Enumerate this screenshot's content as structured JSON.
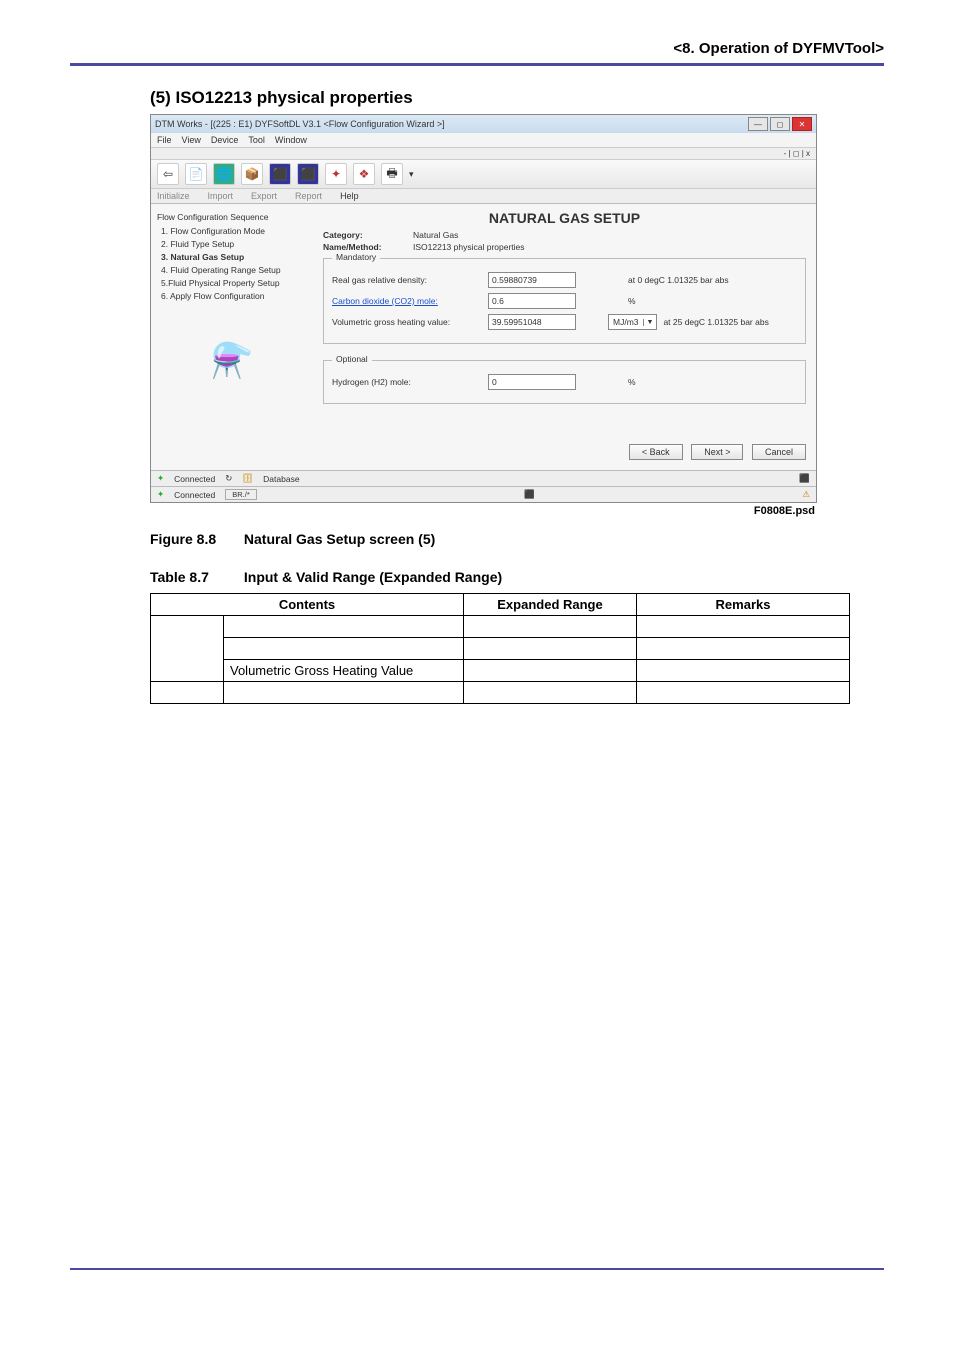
{
  "header": {
    "text": "<8.  Operation of DYFMVTool>"
  },
  "section": {
    "title": "(5)   ISO12213 physical properties"
  },
  "window": {
    "title": "DTM Works - [(225 : E1) DYFSoftDL V3.1 <Flow Configuration Wizard >]",
    "mdi_controls": "- | ◻ | x",
    "menu": {
      "file": "File",
      "view": "View",
      "device": "Device",
      "tool": "Tool",
      "window": "Window"
    },
    "toolbar_icons": {
      "back": "⇦",
      "doc": "📄",
      "globe": "🌐",
      "box": "📦",
      "a1": "⬛",
      "a2": "⬛",
      "wiz1": "✦",
      "wiz2": "❖",
      "print": "🖶",
      "drop": "▾"
    },
    "sectabs": {
      "initialize": "Initialize",
      "import": "Import",
      "export": "Export",
      "report": "Report",
      "help": "Help"
    },
    "sidebar": {
      "group": "Flow Configuration Sequence",
      "steps": {
        "s1": "1. Flow Configuration Mode",
        "s2": "2. Fluid Type Setup",
        "s3": "3. Natural Gas Setup",
        "s4": "4. Fluid Operating Range Setup",
        "s5": "5.Fluid Physical Property Setup",
        "s6": "6. Apply Flow Configuration"
      },
      "art": "⚗️"
    },
    "main": {
      "title": "NATURAL GAS SETUP",
      "catlbl": "Category:",
      "catval": "Natural Gas",
      "methlbl": "Name/Method:",
      "methval": "ISO12213 physical properties",
      "mandatory": {
        "legend": "Mandatory",
        "row1": {
          "label": "Real gas relative density:",
          "value": "0.59880739",
          "cond": "at 0 degC 1.01325 bar abs"
        },
        "row2": {
          "label": "Carbon dioxide (CO2) mole:",
          "value": "0.6",
          "unit": "%"
        },
        "row3": {
          "label": "Volumetric gross heating value:",
          "value": "39.59951048",
          "sel": "MJ/m3",
          "cond": "at 25 degC 1.01325 bar abs"
        }
      },
      "optional": {
        "legend": "Optional",
        "row1": {
          "label": "Hydrogen (H2) mole:",
          "value": "0",
          "unit": "%"
        }
      },
      "buttons": {
        "back": "< Back",
        "next": "Next >",
        "cancel": "Cancel"
      }
    },
    "status": {
      "row1": {
        "conn": "Connected",
        "db": "Database",
        "icon": "⬛"
      },
      "row2": {
        "conn": "Connected",
        "br": "BR./*",
        "mid": "⬛"
      }
    }
  },
  "figure": {
    "id": "F0808E.psd",
    "label": "Figure 8.8",
    "caption": "Natural Gas Setup screen (5)"
  },
  "table": {
    "label": "Table 8.7",
    "caption": "Input & Valid Range (Expanded Range)",
    "head": {
      "c1": "Contents",
      "c2": "Expanded Range",
      "c3": "Remarks"
    },
    "rows": {
      "r3c": "Volumetric Gross Heating Value"
    }
  }
}
